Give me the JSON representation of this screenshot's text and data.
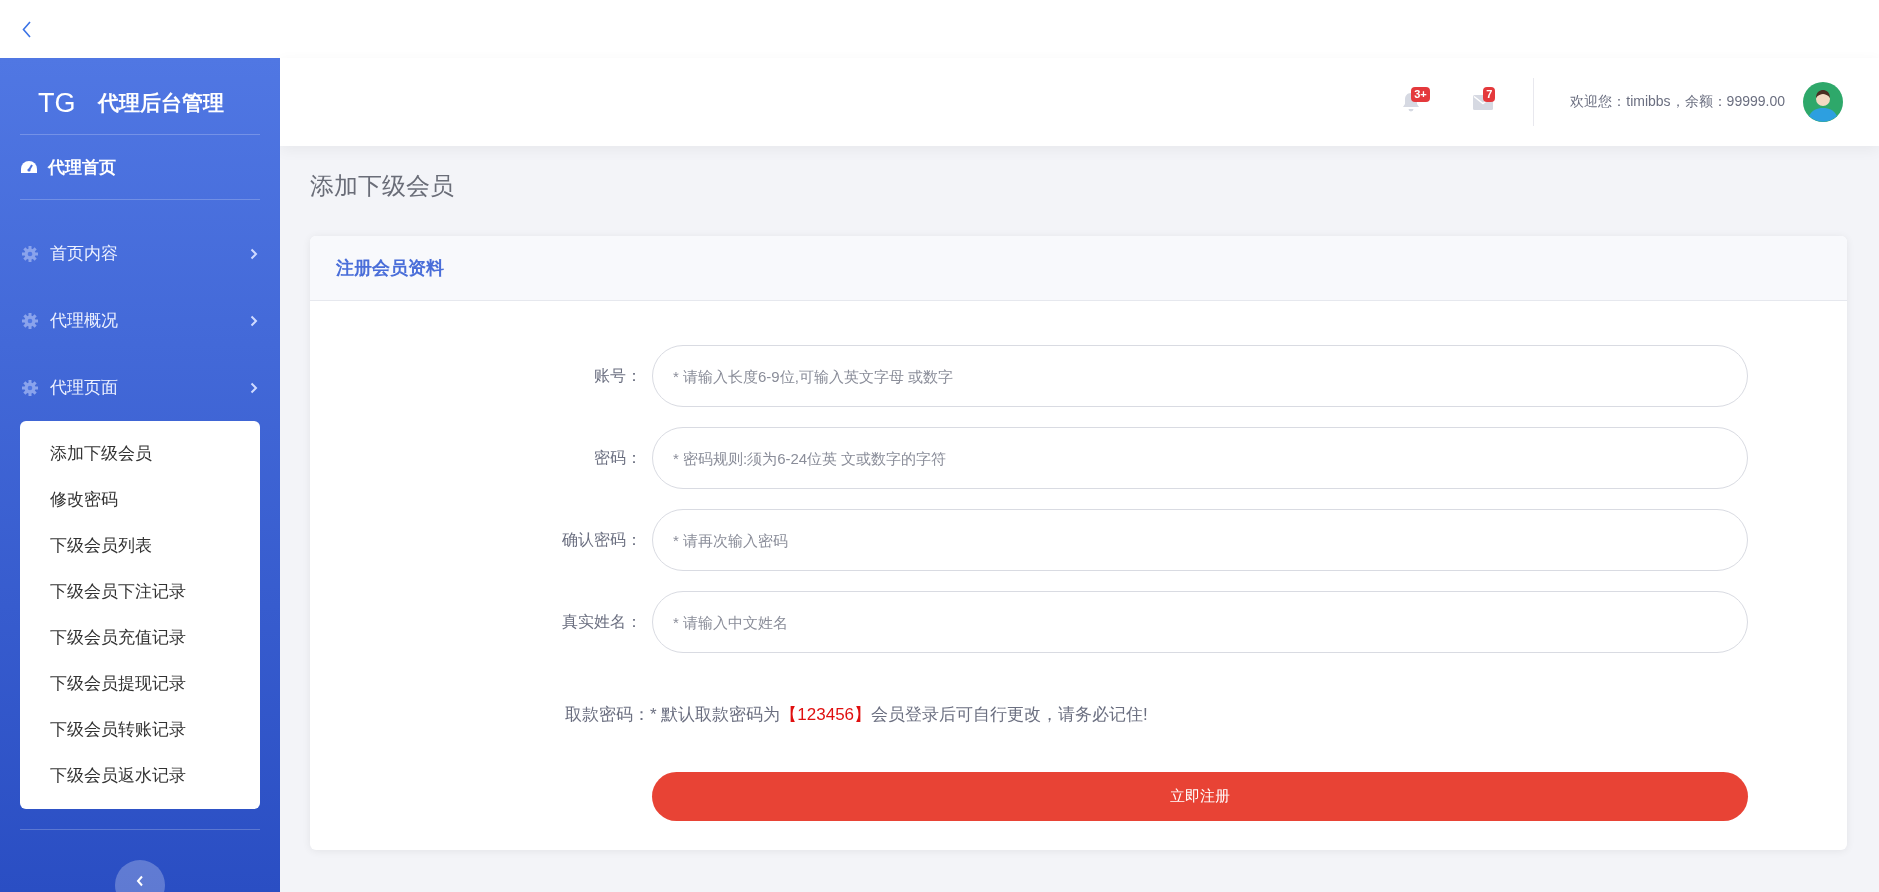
{
  "brand": {
    "logo": "TG",
    "title": "代理后台管理"
  },
  "sidebar": {
    "home": {
      "label": "代理首页"
    },
    "items": [
      {
        "label": "首页内容"
      },
      {
        "label": "代理概况"
      },
      {
        "label": "代理页面",
        "children": [
          {
            "label": "添加下级会员"
          },
          {
            "label": "修改密码"
          },
          {
            "label": "下级会员列表"
          },
          {
            "label": "下级会员下注记录"
          },
          {
            "label": "下级会员充值记录"
          },
          {
            "label": "下级会员提现记录"
          },
          {
            "label": "下级会员转账记录"
          },
          {
            "label": "下级会员返水记录"
          }
        ]
      }
    ]
  },
  "header": {
    "notifications_badge": "3+",
    "messages_badge": "7",
    "welcome": "欢迎您：timibbs，余额：99999.00"
  },
  "page_title": "添加下级会员",
  "form": {
    "title": "注册会员资料",
    "fields": [
      {
        "label": "账号：",
        "placeholder": "* 请输入长度6-9位,可输入英文字母 或数字"
      },
      {
        "label": "密码：",
        "placeholder": "* 密码规则:须为6-24位英 文或数字的字符"
      },
      {
        "label": "确认密码：",
        "placeholder": "* 请再次输入密码"
      },
      {
        "label": "真实姓名：",
        "placeholder": "* 请输入中文姓名"
      }
    ],
    "note": {
      "label": "取款密码：",
      "before": "* 默认取款密码为",
      "highlight": "【123456】",
      "after": "会员登录后可自行更改，请务必记住!"
    },
    "submit": "立即注册"
  }
}
